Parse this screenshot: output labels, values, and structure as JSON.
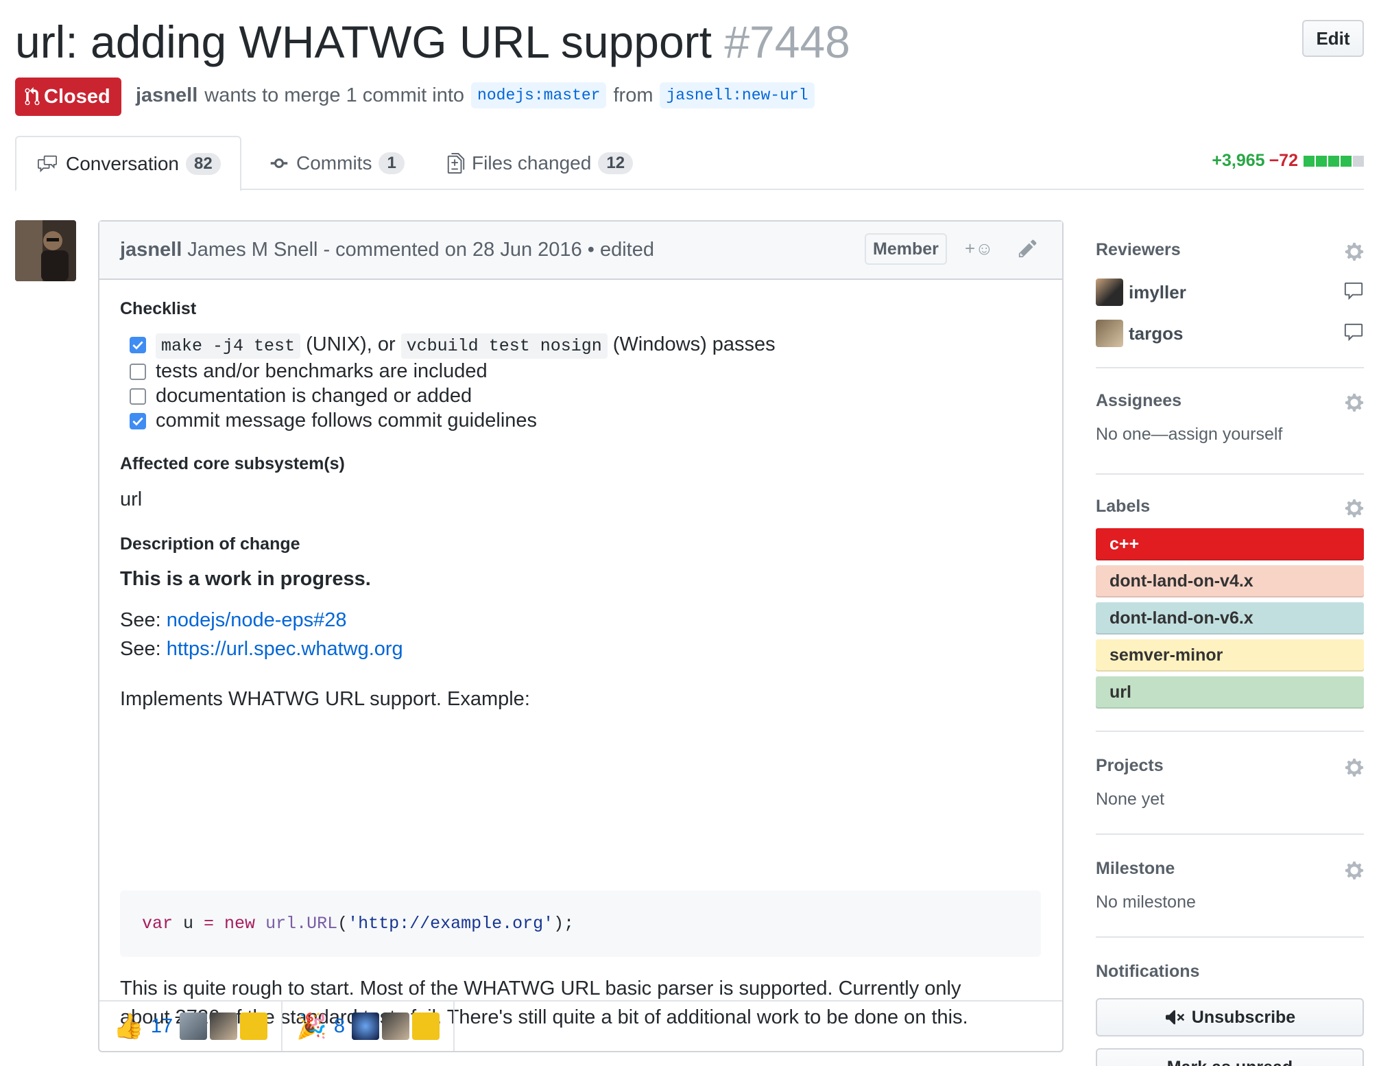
{
  "pr": {
    "title": "url: adding WHATWG URL support",
    "number": "#7448",
    "edit_label": "Edit",
    "state": "Closed",
    "state_color": "#cb2431",
    "author": "jasnell",
    "merge_text": "wants to merge 1 commit into",
    "base_branch": "nodejs:master",
    "from_text": "from",
    "head_branch": "jasnell:new-url"
  },
  "tabs": [
    {
      "label": "Conversation",
      "count": "82",
      "icon": "comment-discussion-icon"
    },
    {
      "label": "Commits",
      "count": "1",
      "icon": "commit-icon"
    },
    {
      "label": "Files changed",
      "count": "12",
      "icon": "file-diff-icon"
    }
  ],
  "diffstat": {
    "additions": "+3,965",
    "deletions": "−72"
  },
  "comment": {
    "author": "jasnell",
    "full_name": "James M Snell",
    "meta": "- commented on 28 Jun 2016 • edited",
    "badge": "Member",
    "react_symbol": "+☺",
    "checklist_heading": "Checklist",
    "tasks": [
      {
        "checked": true,
        "code1": "make -j4 test",
        "text1": "(UNIX), or",
        "code2": "vcbuild test nosign",
        "text2": "(Windows) passes"
      },
      {
        "checked": false,
        "text": "tests and/or benchmarks are included"
      },
      {
        "checked": false,
        "text": "documentation is changed or added"
      },
      {
        "checked": true,
        "text": "commit message follows commit guidelines"
      }
    ],
    "subsystem_heading": "Affected core subsystem(s)",
    "subsystem": "url",
    "description_heading": "Description of change",
    "wip": "This is a work in progress.",
    "see_label": "See:",
    "see_link1": "nodejs/node-eps#28",
    "see_link2": "https://url.spec.whatwg.org",
    "implements": "Implements WHATWG URL support. Example:",
    "code": {
      "kw1": "var",
      "v": " u ",
      "eq": "=",
      "kw2": " new",
      "fn": " url.URL",
      "open": "(",
      "str": "'http://example.org'",
      "close": ");"
    },
    "para1": "This is quite rough to start. Most of the WHATWG URL basic parser is supported. Currently only",
    "para2_pre": "about ",
    "para2_strike": "27",
    "para2_post": "26 of the standard tests fail. There's still quite a bit of additional work to be done on this.",
    "reactions": [
      {
        "emoji": "👍",
        "count": "17"
      },
      {
        "emoji": "🎉",
        "count": "8"
      }
    ]
  },
  "sidebar": {
    "reviewers_title": "Reviewers",
    "reviewers": [
      "imyller",
      "targos"
    ],
    "assignees_title": "Assignees",
    "assignees_value": "No one—assign yourself",
    "labels_title": "Labels",
    "labels": [
      {
        "name": "c++",
        "bg": "#e11d21",
        "fg": "#ffffff"
      },
      {
        "name": "dont-land-on-v4.x",
        "bg": "#f7d4c6",
        "fg": "#333333"
      },
      {
        "name": "dont-land-on-v6.x",
        "bg": "#c2dfe0",
        "fg": "#333333"
      },
      {
        "name": "semver-minor",
        "bg": "#fef2c0",
        "fg": "#333333"
      },
      {
        "name": "url",
        "bg": "#c2e0c6",
        "fg": "#333333"
      }
    ],
    "projects_title": "Projects",
    "projects_value": "None yet",
    "milestone_title": "Milestone",
    "milestone_value": "No milestone",
    "notifications_title": "Notifications",
    "unsubscribe_label": "Unsubscribe",
    "mark_unread_label": "Mark as unread"
  }
}
